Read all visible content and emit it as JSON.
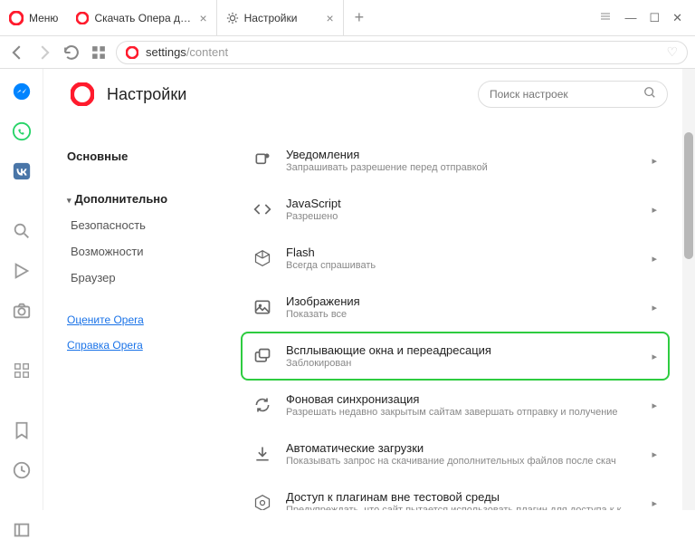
{
  "titlebar": {
    "menu_label": "Меню",
    "tabs": [
      {
        "label": "Скачать Опера для комп",
        "icon": "opera"
      },
      {
        "label": "Настройки",
        "icon": "gear"
      }
    ],
    "active_tab": 1
  },
  "addressbar": {
    "url_prefix": "settings",
    "url_path": "/content"
  },
  "page": {
    "title": "Настройки",
    "search_placeholder": "Поиск настроек"
  },
  "sidebar": {
    "sections": [
      {
        "label": "Основные",
        "type": "bold"
      },
      {
        "label": "Дополнительно",
        "type": "expand-bold"
      },
      {
        "label": "Безопасность",
        "type": "sub"
      },
      {
        "label": "Возможности",
        "type": "sub"
      },
      {
        "label": "Браузер",
        "type": "sub"
      }
    ],
    "links": [
      "Оцените Opera",
      "Справка Opera"
    ]
  },
  "settings": [
    {
      "icon": "bell",
      "title": "Уведомления",
      "sub": "Запрашивать разрешение перед отправкой"
    },
    {
      "icon": "code",
      "title": "JavaScript",
      "sub": "Разрешено"
    },
    {
      "icon": "cube",
      "title": "Flash",
      "sub": "Всегда спрашивать"
    },
    {
      "icon": "image",
      "title": "Изображения",
      "sub": "Показать все"
    },
    {
      "icon": "popup",
      "title": "Всплывающие окна и переадресация",
      "sub": "Заблокирован",
      "highlighted": true
    },
    {
      "icon": "sync",
      "title": "Фоновая синхронизация",
      "sub": "Разрешать недавно закрытым сайтам завершать отправку и получение"
    },
    {
      "icon": "download",
      "title": "Автоматические загрузки",
      "sub": "Показывать запрос на скачивание дополнительных файлов после скач"
    },
    {
      "icon": "plugin",
      "title": "Доступ к плагинам вне тестовой среды",
      "sub": "Предупреждать, что сайт пытается использовать плагин для доступа к к"
    }
  ]
}
